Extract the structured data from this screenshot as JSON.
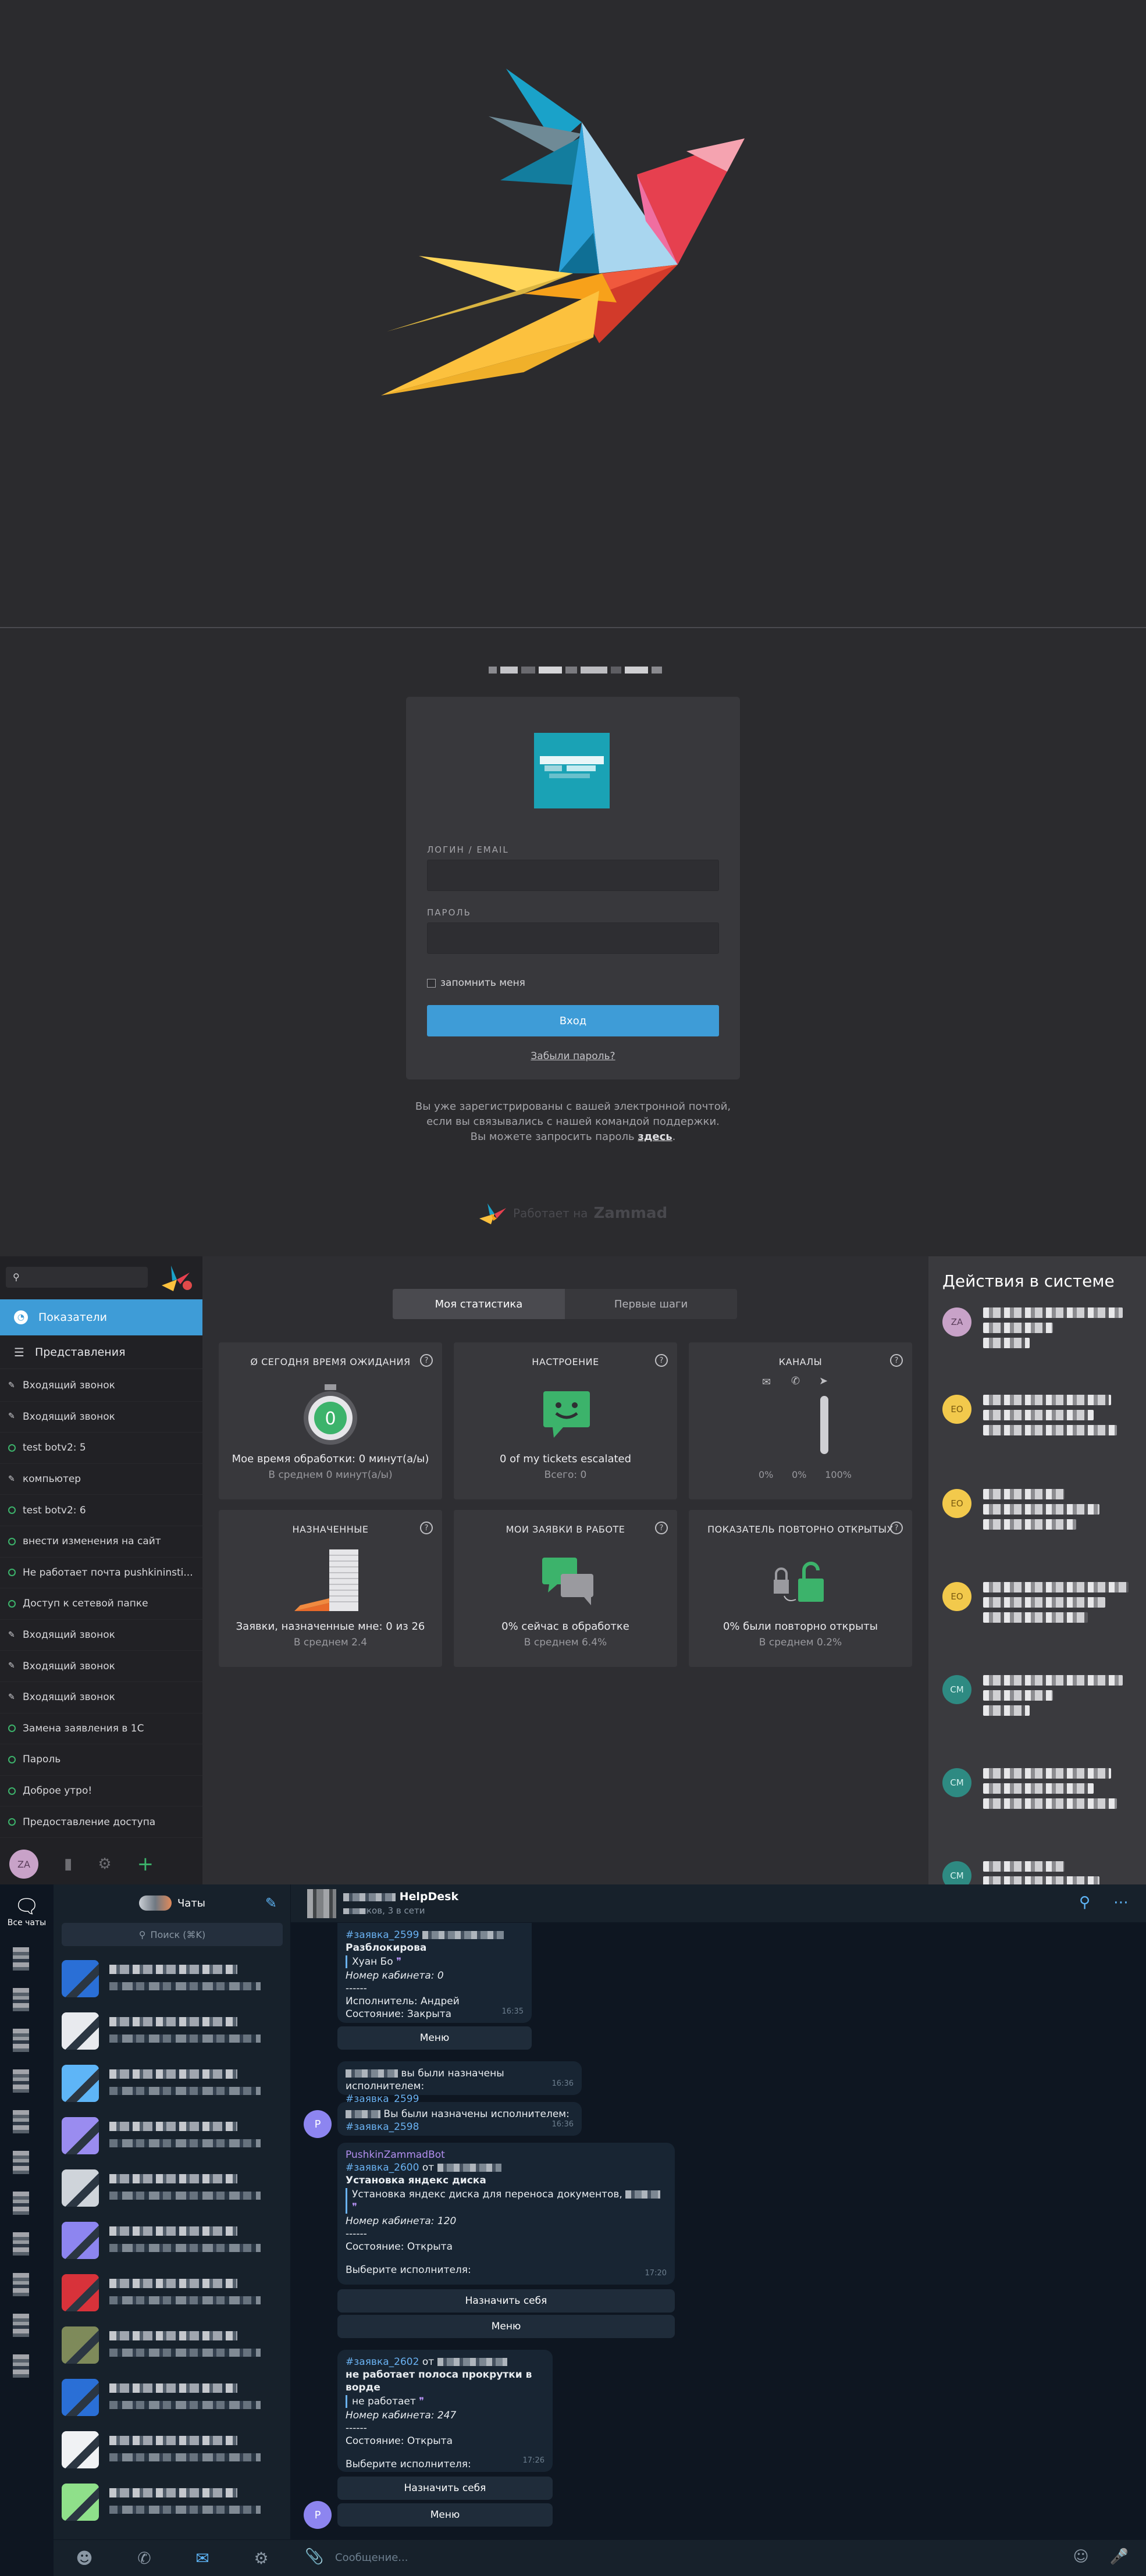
{
  "login": {
    "username_label": "ЛОГИН / EMAIL",
    "password_label": "ПАРОЛЬ",
    "remember_label": "запомнить меня",
    "submit_label": "Вход",
    "forgot_label": "Забыли пароль?",
    "note_line1": "Вы уже зарегистрированы с вашей электронной почтой,",
    "note_line2": "если вы связывались с нашей командой поддержки.",
    "note_line3": "Вы можете запросить пароль",
    "note_link": "здесь",
    "note_end": ".",
    "powered_prefix": "Работает на",
    "powered_brand": "Zammad"
  },
  "dashboard": {
    "nav_dashboard": "Показатели",
    "nav_views": "Представления",
    "tickets": [
      {
        "label": "Входящий звонок",
        "state": "pen"
      },
      {
        "label": "Входящий звонок",
        "state": "pen"
      },
      {
        "label": "test botv2: 5",
        "state": "ring"
      },
      {
        "label": "компьютер",
        "state": "pen"
      },
      {
        "label": "test botv2: 6",
        "state": "ring"
      },
      {
        "label": "внести изменения на сайт",
        "state": "ring"
      },
      {
        "label": "Не работает почта pushkininsti...",
        "state": "ring"
      },
      {
        "label": "Доступ к сетевой папке",
        "state": "ring"
      },
      {
        "label": "Входящий звонок",
        "state": "pen"
      },
      {
        "label": "Входящий звонок",
        "state": "pen"
      },
      {
        "label": "Входящий звонок",
        "state": "pen"
      },
      {
        "label": "Замена заявления в 1С",
        "state": "ring"
      },
      {
        "label": "Пароль",
        "state": "ring"
      },
      {
        "label": "Доброе утро!",
        "state": "ring"
      },
      {
        "label": "Предоставление доступа",
        "state": "ring"
      }
    ],
    "user_initials": "ZA",
    "tab_stats": "Моя статистика",
    "tab_first_steps": "Первые шаги",
    "widgets": {
      "wait_title": "Ø СЕГОДНЯ ВРЕМЯ ОЖИДАНИЯ",
      "wait_value": "0",
      "wait_l1": "Мое время обработки: 0 минут(а/ы)",
      "wait_l2": "В среднем 0 минут(а/ы)",
      "mood_title": "НАСТРОЕНИЕ",
      "mood_l1": "0 of my tickets escalated",
      "mood_l2": "Всего: 0",
      "channels_title": "КАНАЛЫ",
      "channels_values": [
        "0%",
        "0%",
        "100%"
      ],
      "assigned_title": "НАЗНАЧЕННЫЕ",
      "assigned_l1": "Заявки, назначенные мне: 0 из 26",
      "assigned_l2": "В среднем 2.4",
      "inwork_title": "МОИ ЗАЯВКИ В РАБОТЕ",
      "inwork_l1": "0% сейчас в обработке",
      "inwork_l2": "В среднем 6.4%",
      "reopen_title": "ПОКАЗАТЕЛЬ ПОВТОРНО ОТКРЫТЫХ",
      "reopen_l1": "0% были повторно открыты",
      "reopen_l2": "В среднем 0.2%",
      "help_glyph": "?"
    },
    "activity_title": "Действия в системе",
    "activity_avatars": [
      {
        "initials": "ZA",
        "bg": "#c8a2c8",
        "fg": "#5a3d5a"
      },
      {
        "initials": "EO",
        "bg": "#f2c94c",
        "fg": "#7a5a10"
      },
      {
        "initials": "EO",
        "bg": "#f2c94c",
        "fg": "#7a5a10"
      },
      {
        "initials": "EO",
        "bg": "#f2c94c",
        "fg": "#7a5a10"
      },
      {
        "initials": "CM",
        "bg": "#2e8a82",
        "fg": "#d6f2ef"
      },
      {
        "initials": "CM",
        "bg": "#2e8a82",
        "fg": "#d6f2ef"
      },
      {
        "initials": "CM",
        "bg": "#2e8a82",
        "fg": "#d6f2ef"
      }
    ]
  },
  "telegram": {
    "all_chats_label": "Все чаты",
    "list_title": "Чаты",
    "search_placeholder": "Поиск (⌘K)",
    "chat_title": "HelpDesk",
    "chat_subtitle": "ков, 3 в сети",
    "input_placeholder": "Сообщение...",
    "msg1": {
      "ticket": "#заявка_2599",
      "subject": "Разблокирова",
      "quote": "Хуан Бо",
      "room": "Номер кабинета: 0",
      "sep": "------",
      "executor": "Исполнитель: Андрей",
      "state": "Состояние: Закрыта",
      "time": "16:35"
    },
    "menu_label": "Меню",
    "msg2": {
      "text": "вы были назначены исполнителем:",
      "ticket": "#заявка_2599",
      "time": "16:36"
    },
    "msg3": {
      "text": "Вы были назначены исполнителем:",
      "ticket": "#заявка_2598",
      "time": "16:36"
    },
    "msg4": {
      "bot": "PushkinZammadBot",
      "ticket": "#заявка_2600",
      "from": "от",
      "subject": "Установка яндекс диска",
      "quote": "Установка яндекс диска для переноса документов,",
      "room": "Номер кабинета: 120",
      "sep": "------",
      "state": "Состояние: Открыта",
      "choose": "Выберите исполнителя:",
      "time": "17:20"
    },
    "assign_self_label": "Назначить себя",
    "msg5": {
      "ticket": "#заявка_2602",
      "from": "от",
      "subject": "не работает полоса прокрутки в ворде",
      "quote": "не работает",
      "room": "Номер кабинета: 247",
      "sep": "------",
      "state": "Состояние: Открыта",
      "choose": "Выберите исполнителя:",
      "time": "17:26"
    },
    "p_initial": "P"
  },
  "colors": {
    "accent": "#3e9cd7",
    "green": "#3cb36b",
    "tg_link": "#6ab2f2"
  }
}
